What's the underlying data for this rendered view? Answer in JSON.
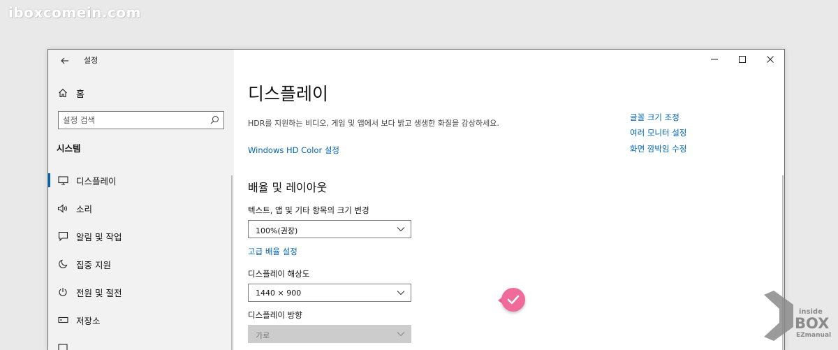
{
  "watermark": "iboxcomein.com",
  "window": {
    "title": "설정",
    "controls": {
      "minimize_icon": "minimize-icon",
      "maximize_icon": "maximize-icon",
      "close_icon": "close-icon"
    }
  },
  "sidebar": {
    "home_label": "홈",
    "search_placeholder": "설정 검색",
    "section_title": "시스템",
    "items": [
      {
        "label": "디스플레이",
        "icon": "monitor-icon",
        "active": true
      },
      {
        "label": "소리",
        "icon": "speaker-icon",
        "active": false
      },
      {
        "label": "알림 및 작업",
        "icon": "notification-icon",
        "active": false
      },
      {
        "label": "집중 지원",
        "icon": "moon-icon",
        "active": false
      },
      {
        "label": "전원 및 절전",
        "icon": "power-icon",
        "active": false
      },
      {
        "label": "저장소",
        "icon": "storage-icon",
        "active": false
      }
    ]
  },
  "main": {
    "title": "디스플레이",
    "description": "HDR를 지원하는 비디오, 게임 및 앱에서 보다 밝고 생생한 화질을 감상하세요.",
    "hdr_link": "Windows HD Color 설정",
    "related_links": [
      "글꼴 크기 조정",
      "여러 모니터 설정",
      "화면 깜박임 수정"
    ],
    "scale_section": {
      "heading": "배율 및 레이아웃",
      "text_size_label": "텍스트, 앱 및 기타 항목의 크기 변경",
      "text_size_value": "100%(권장)",
      "advanced_link": "고급 배율 설정",
      "resolution_label": "디스플레이 해상도",
      "resolution_value": "1440 × 900",
      "orientation_label": "디스플레이 방향",
      "orientation_value": "가로"
    }
  },
  "logo": {
    "top": "inside",
    "middle": "BOX",
    "bottom": "EZmanual"
  },
  "colors": {
    "accent": "#0063b1",
    "badge": "#f06a9a",
    "sidebar_bg": "#f2f2f2"
  }
}
